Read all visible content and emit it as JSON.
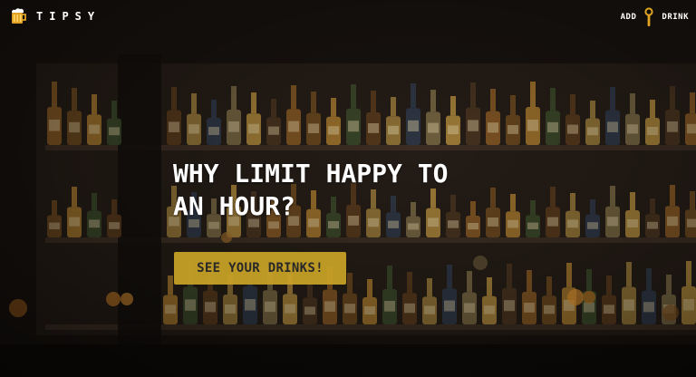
{
  "brand": {
    "name": "TIPSY",
    "icon": "beer-mug-icon"
  },
  "nav": {
    "add_word": "ADD",
    "drink_word": "DRINK",
    "icon": "tap-handle-icon"
  },
  "hero": {
    "headline_line1": "WHY LIMIT HAPPY TO",
    "headline_line2": "AN HOUR?",
    "cta_label": "SEE YOUR DRINKS!"
  },
  "colors": {
    "accent": "#c9a227",
    "text": "#ffffff",
    "background": "#1a1714"
  }
}
